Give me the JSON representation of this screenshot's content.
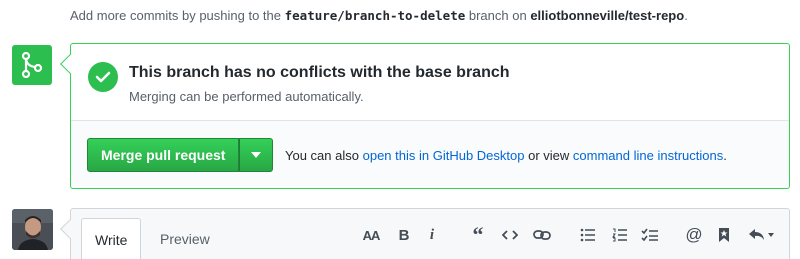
{
  "info": {
    "prefix": "Add more commits by pushing to the",
    "branch": "feature/branch-to-delete",
    "middle": "branch on",
    "repo": "elliotbonneville/test-repo",
    "suffix": "."
  },
  "merge": {
    "title": "This branch has no conflicts with the base branch",
    "subtitle": "Merging can be performed automatically.",
    "button_label": "Merge pull request",
    "also_prefix": "You can also",
    "desktop_link": "open this in GitHub Desktop",
    "or_view": "or view",
    "cli_link": "command line instructions",
    "period": "."
  },
  "comment": {
    "tabs": [
      "Write",
      "Preview"
    ],
    "toolbar_icons": [
      "text-size-icon",
      "bold-icon",
      "italic-icon",
      "quote-icon",
      "code-icon",
      "link-icon",
      "bulleted-list-icon",
      "numbered-list-icon",
      "task-list-icon",
      "mention-icon",
      "bookmark-icon",
      "reply-icon"
    ],
    "toolbar_glyphs": {
      "text_size": "AA",
      "bold": "B",
      "italic": "i",
      "quote": "“",
      "mention": "@"
    }
  },
  "colors": {
    "accent_green": "#2cbe4e",
    "link_blue": "#0366d6"
  }
}
